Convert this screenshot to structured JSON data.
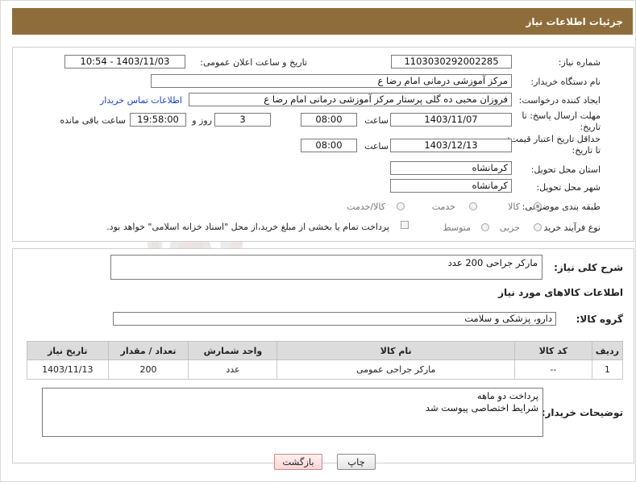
{
  "header": {
    "title": "جزئیات اطلاعات نیاز"
  },
  "form": {
    "need_number_label": "شماره نیاز:",
    "need_number": "1103030292002285",
    "announce_label": "تاریخ و ساعت اعلان عمومی:",
    "announce_value": "1403/11/03 - 10:54",
    "buyer_org_label": "نام دستگاه خریدار:",
    "buyer_org": "مرکز آموزشی  درمانی امام رضا  ع",
    "creator_label": "ایجاد کننده درخواست:",
    "creator": "فروزان محبی ده گلی پرستار مرکز آموزشی  درمانی امام رضا  ع",
    "contact_link": "اطلاعات تماس خریدار",
    "deadline_label": "مهلت ارسال پاسخ: تا تاریخ:",
    "deadline_date": "1403/11/07",
    "time_label": "ساعت",
    "deadline_time": "08:00",
    "days_label": "روز و",
    "days": "3",
    "remaining_time": "19:58:00",
    "remaining_label": "ساعت باقی مانده",
    "validity_label": "حداقل تاریخ اعتبار قیمت: تا تاریخ:",
    "validity_date": "1403/12/13",
    "validity_time": "08:00",
    "province_label": "استان محل تحویل:",
    "province": "کرمانشاه",
    "city_label": "شهر محل تحویل:",
    "city": "کرمانشاه",
    "category_label": "طبقه بندی موضوعی:",
    "category_options": [
      "کالا",
      "خدمت",
      "کالا/خدمت"
    ],
    "process_label": "نوع فرآیند خرید :",
    "process_options": [
      "جزیی",
      "متوسط"
    ],
    "treasury_note": "پرداخت تمام یا بخشی از مبلغ خرید،از محل \"اسناد خزانه اسلامی\" خواهد بود."
  },
  "description": {
    "label": "شرح کلی نیاز:",
    "value": "مارکر جراحی 200 عدد"
  },
  "goods_info": {
    "title": "اطلاعات کالاهای مورد نیاز",
    "group_label": "گروه کالا:",
    "group_value": "دارو، پزشکی و سلامت"
  },
  "table": {
    "headers": [
      "ردیف",
      "کد کالا",
      "نام کالا",
      "واحد شمارش",
      "تعداد / مقدار",
      "تاریخ نیاز"
    ],
    "rows": [
      [
        "1",
        "--",
        "مارکر جراحی عمومی",
        "عدد",
        "200",
        "1403/11/13"
      ]
    ]
  },
  "buyer_notes": {
    "label": "توضیحات خریدار:",
    "value": "پرداخت دو ماهه\nشرایط اختصاصی پیوست شد"
  },
  "buttons": {
    "print": "چاپ",
    "back": "بازگشت"
  },
  "watermark": {
    "text": "AriaTender.neT"
  },
  "colors": {
    "header_bg": "#8f6d3a",
    "link": "#1a44c8",
    "table_header_bg": "#dcdcdc"
  }
}
